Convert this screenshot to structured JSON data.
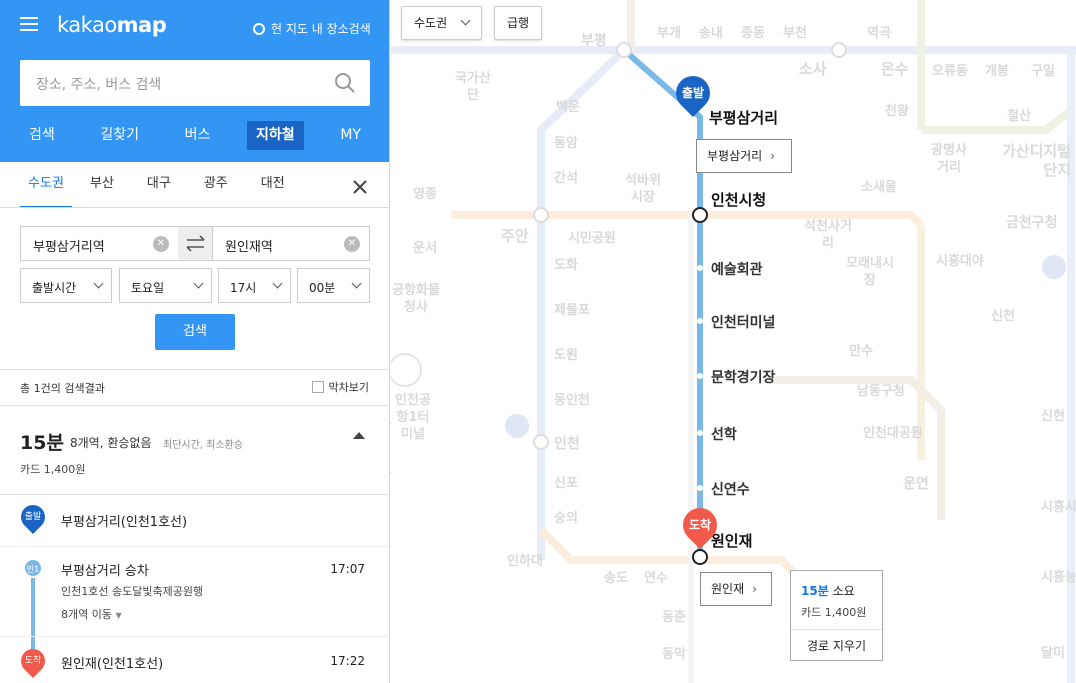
{
  "app": {
    "logo_light": "kakao",
    "logo_bold": "map",
    "nearby_label": "현 지도 내 장소검색"
  },
  "search": {
    "placeholder": "장소, 주소, 버스 검색"
  },
  "nav": [
    "검색",
    "길찾기",
    "버스",
    "지하철",
    "MY"
  ],
  "nav_active": "지하철",
  "cities": [
    "수도권",
    "부산",
    "대구",
    "광주",
    "대전"
  ],
  "route": {
    "from": "부평삼거리역",
    "to": "원인재역"
  },
  "options": {
    "depart_type": "출발시간",
    "day": "토요일",
    "hour": "17시",
    "minute": "00분"
  },
  "search_button": "검색",
  "results": {
    "count_label": "총 1건의 검색결과",
    "last_train_label": "막차보기"
  },
  "result": {
    "time": "15분",
    "summary": "8개역, 환승없음",
    "tags": "최단시간, 최소환승",
    "fare": "카드 1,400원"
  },
  "steps": {
    "start_badge": "출발",
    "start_name": "부평삼거리(인천1호선)",
    "board_badge": "인1",
    "board_name": "부평삼거리 승차",
    "board_time": "17:07",
    "board_line": "인천1호선 송도달빛축제공원행",
    "board_stops": "8개역 이동",
    "end_badge": "도착",
    "end_name": "원인재(인천1호선)",
    "end_time": "17:22"
  },
  "map": {
    "region_select": "수도권",
    "express_button": "급행",
    "start_pin": "출발",
    "end_pin": "도착",
    "start_label": "부평삼거리",
    "end_label": "원인재",
    "stations": [
      "부평삼거리",
      "인천시청",
      "예술회관",
      "인천터미널",
      "문학경기장",
      "선학",
      "신연수",
      "원인재"
    ],
    "popup": {
      "time": "15분",
      "time_suffix": "소요",
      "fare": "카드 1,400원",
      "clear": "경로 지우기"
    },
    "bg_labels": [
      "부평",
      "부개",
      "송내",
      "중동",
      "부천",
      "역곡",
      "소사",
      "온수",
      "오류동",
      "개봉",
      "구일",
      "천왕",
      "철산",
      "광명사거리",
      "가산디지털단지",
      "금천구청",
      "주안",
      "국가산단",
      "백운",
      "동암",
      "간석",
      "석바위시장",
      "영종",
      "운서",
      "공항화물청사",
      "주안",
      "시민공원",
      "도화",
      "제물포",
      "도원",
      "동인천",
      "인천",
      "신포",
      "숭의",
      "인하대",
      "송도",
      "연수",
      "동춘",
      "동막",
      "석천사거리",
      "모래내시장",
      "만수",
      "남동구청",
      "인천대공원",
      "운연",
      "소새울",
      "시흥대야",
      "신천",
      "신현",
      "시흥시청",
      "시흥능곡",
      "달미",
      "인천공항1터미널"
    ]
  }
}
